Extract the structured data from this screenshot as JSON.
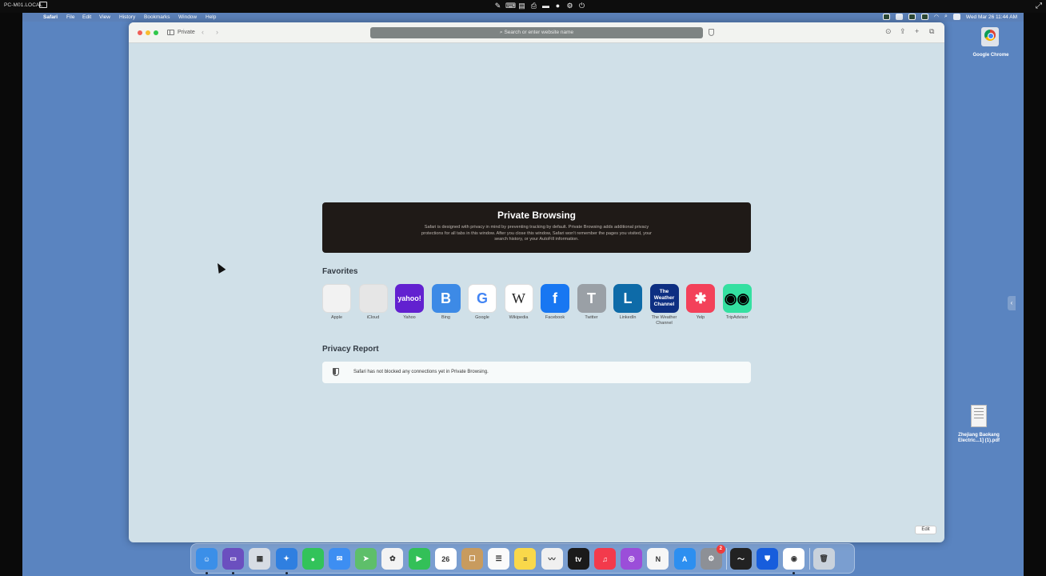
{
  "viewer": {
    "host": "PC-M01.LOCAL"
  },
  "menubar": {
    "app": "Safari",
    "items": [
      "File",
      "Edit",
      "View",
      "History",
      "Bookmarks",
      "Window",
      "Help"
    ],
    "clock": "Wed Mar 26  11:44 AM"
  },
  "desktop": {
    "icons": [
      {
        "label": "Google Chrome"
      },
      {
        "label_line1": "Zhejiang Baokang",
        "label_line2": "Electric...1] (1).pdf"
      }
    ]
  },
  "safari": {
    "private_label": "Private",
    "address_placeholder": "Search or enter website name",
    "banner_title": "Private Browsing",
    "banner_text": "Safari is designed with privacy in mind by preventing tracking by default. Private Browsing adds additional privacy protections for all tabs in this window. After you close this window, Safari won't remember the pages you visited, your search history, or your AutoFill information.",
    "favorites_title": "Favorites",
    "favorites": [
      {
        "label": "Apple",
        "glyph": "",
        "bg": "#f2f2f2",
        "fg": "#555"
      },
      {
        "label": "iCloud",
        "glyph": "",
        "bg": "#e6e6e6",
        "fg": "#888"
      },
      {
        "label": "Yahoo",
        "glyph": "yahoo!",
        "bg": "#6221d0",
        "fg": "#fff"
      },
      {
        "label": "Bing",
        "glyph": "B",
        "bg": "#3d8ae6",
        "fg": "#fff"
      },
      {
        "label": "Google",
        "glyph": "G",
        "bg": "#ffffff",
        "fg": "#4285f4"
      },
      {
        "label": "Wikipedia",
        "glyph": "W",
        "bg": "#ffffff",
        "fg": "#222"
      },
      {
        "label": "Facebook",
        "glyph": "f",
        "bg": "#1877f2",
        "fg": "#fff"
      },
      {
        "label": "Twitter",
        "glyph": "T",
        "bg": "#9aa0a6",
        "fg": "#fff"
      },
      {
        "label": "LinkedIn",
        "glyph": "L",
        "bg": "#0e6ba8",
        "fg": "#fff"
      },
      {
        "label": "The Weather Channel",
        "glyph": "The Weather Channel",
        "bg": "#0d2f82",
        "fg": "#fff"
      },
      {
        "label": "Yelp",
        "glyph": "✱",
        "bg": "#f3415a",
        "fg": "#fff"
      },
      {
        "label": "TripAdvisor",
        "glyph": "◉◉",
        "bg": "#34e0a1",
        "fg": "#000"
      }
    ],
    "privacy_title": "Privacy Report",
    "privacy_text": "Safari has not blocked any connections yet in Private Browsing.",
    "edit_label": "Edit"
  },
  "dock": {
    "apps": [
      {
        "name": "finder",
        "color": "#3b8fe8",
        "glyph": "☺",
        "running": true
      },
      {
        "name": "app-2",
        "color": "#6b4fbf",
        "glyph": "▭",
        "running": true
      },
      {
        "name": "launchpad",
        "color": "#d7dce4",
        "glyph": "▦",
        "running": false
      },
      {
        "name": "safari",
        "color": "#2f7fe0",
        "glyph": "✦",
        "running": true
      },
      {
        "name": "messages",
        "color": "#32c35a",
        "glyph": "●",
        "running": false
      },
      {
        "name": "mail",
        "color": "#3d8ef2",
        "glyph": "✉",
        "running": false
      },
      {
        "name": "maps",
        "color": "#5ebf6a",
        "glyph": "➤",
        "running": false
      },
      {
        "name": "photos",
        "color": "#f3f3f3",
        "glyph": "✿",
        "running": false
      },
      {
        "name": "facetime",
        "color": "#33c058",
        "glyph": "▶",
        "running": false
      },
      {
        "name": "calendar",
        "color": "#ffffff",
        "glyph": "26",
        "running": false
      },
      {
        "name": "contacts",
        "color": "#c89b5e",
        "glyph": "☐",
        "running": false
      },
      {
        "name": "reminders",
        "color": "#fafafa",
        "glyph": "☰",
        "running": false
      },
      {
        "name": "notes",
        "color": "#f9d84a",
        "glyph": "≡",
        "running": false
      },
      {
        "name": "freeform",
        "color": "#f0f0f0",
        "glyph": "〰",
        "running": false
      },
      {
        "name": "apple-tv",
        "color": "#1a1a1a",
        "glyph": "tv",
        "running": false
      },
      {
        "name": "music",
        "color": "#f33a4c",
        "glyph": "♫",
        "running": false
      },
      {
        "name": "podcasts",
        "color": "#9b4ed9",
        "glyph": "◎",
        "running": false
      },
      {
        "name": "news",
        "color": "#f6f6f6",
        "glyph": "N",
        "running": false
      },
      {
        "name": "app-store",
        "color": "#2d8ff0",
        "glyph": "A",
        "running": false
      },
      {
        "name": "system-settings",
        "color": "#8d9096",
        "glyph": "⚙",
        "running": false,
        "badge": "2"
      },
      {
        "name": "activity-monitor",
        "color": "#222",
        "glyph": "〜",
        "running": false
      },
      {
        "name": "bitwarden",
        "color": "#175ddc",
        "glyph": "⛊",
        "running": false
      },
      {
        "name": "google-chrome",
        "color": "#ffffff",
        "glyph": "◉",
        "running": true
      },
      {
        "name": "trash",
        "color": "#c9d2dc",
        "glyph": "🗑",
        "running": false
      }
    ]
  }
}
